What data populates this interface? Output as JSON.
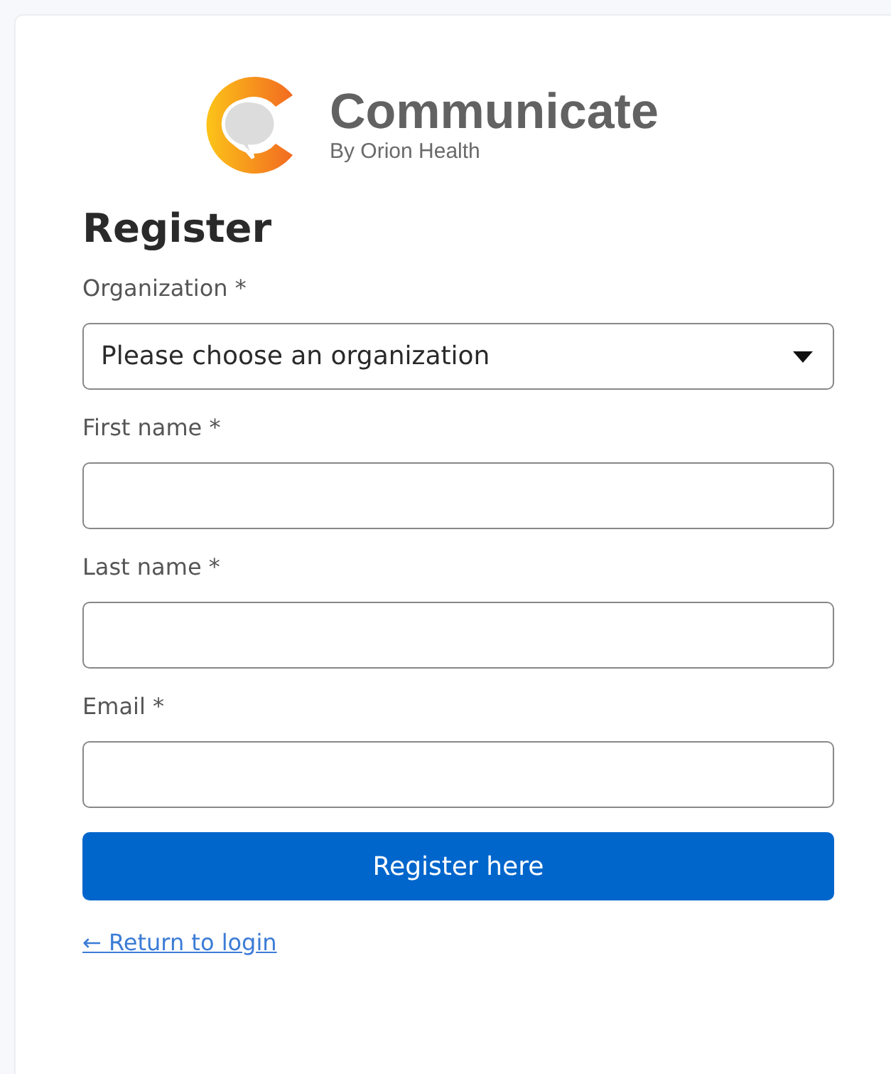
{
  "logo": {
    "name": "Communicate",
    "tagline": "By Orion Health"
  },
  "heading": "Register",
  "fields": [
    {
      "label": "Organization *",
      "kind": "select",
      "value": "Please choose an organization"
    },
    {
      "label": "First name *",
      "kind": "text"
    },
    {
      "label": "Last name *",
      "kind": "text"
    },
    {
      "label": "Email *",
      "kind": "text"
    }
  ],
  "submit": "Register here",
  "back_link": "← Return to login"
}
